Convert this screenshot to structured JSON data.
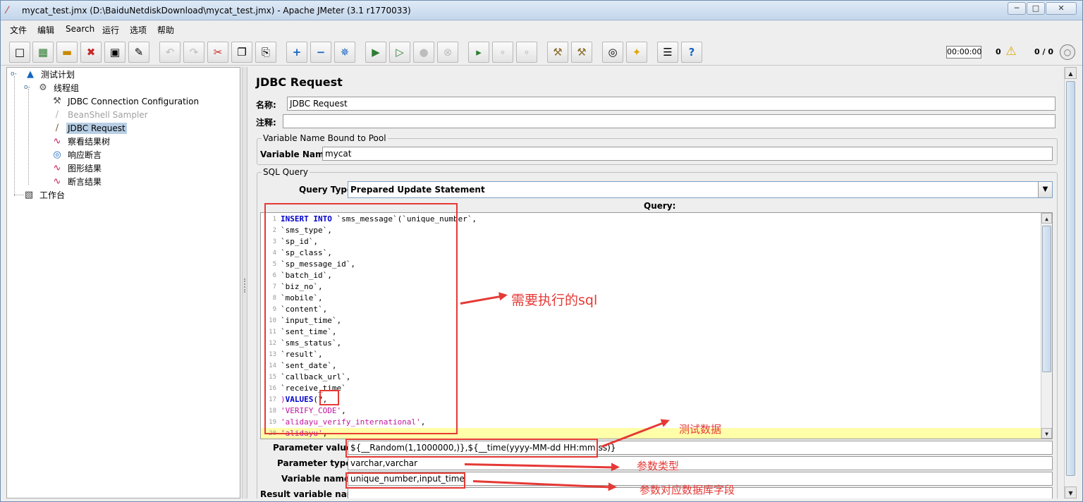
{
  "window": {
    "title": "mycat_test.jmx (D:\\BaiduNetdiskDownload\\mycat_test.jmx) - Apache JMeter (3.1 r1770033)",
    "controls": {
      "minimize": "─",
      "maximize": "□",
      "close": "✕"
    }
  },
  "menu": [
    "文件",
    "编辑",
    "Search",
    "运行",
    "选项",
    "帮助"
  ],
  "toolbar": {
    "timer": "00:00:00",
    "error_count": "0",
    "threads": "0 / 0"
  },
  "tree": {
    "root": "测试计划",
    "thread_group": "线程组",
    "children": [
      "JDBC Connection Configuration",
      "BeanShell Sampler",
      "JDBC Request",
      "察看结果树",
      "响应断言",
      "图形结果",
      "断言结果"
    ],
    "workbench": "工作台"
  },
  "panel": {
    "title": "JDBC Request",
    "name_label": "名称:",
    "name_value": "JDBC Request",
    "comment_label": "注释:",
    "comment_value": "",
    "pool_group": "Variable Name Bound to Pool",
    "var_name_label": "Variable Name:",
    "var_name_value": "mycat",
    "sql_group": "SQL Query",
    "query_type_label": "Query Type:",
    "query_type_value": "Prepared Update Statement",
    "query_label": "Query:",
    "param_values_label": "Parameter values:",
    "param_values": "${__Random(1,1000000,)},${__time(yyyy-MM-dd  HH:mm:ss)}",
    "param_types_label": "Parameter types:",
    "param_types": "varchar,varchar",
    "variable_names_label": "Variable names:",
    "variable_names": "unique_number,input_time",
    "result_var_label": "Result variable name:"
  },
  "query_lines": [
    {
      "n": "1",
      "t": "INSERT INTO `sms_message`(`unique_number`,"
    },
    {
      "n": "2",
      "t": "`sms_type`,"
    },
    {
      "n": "3",
      "t": "`sp_id`,"
    },
    {
      "n": "4",
      "t": "`sp_class`,"
    },
    {
      "n": "5",
      "t": "`sp_message_id`,"
    },
    {
      "n": "6",
      "t": "`batch_id`,"
    },
    {
      "n": "7",
      "t": "`biz_no`,"
    },
    {
      "n": "8",
      "t": "`mobile`,"
    },
    {
      "n": "9",
      "t": "`content`,"
    },
    {
      "n": "10",
      "t": "`input_time`,"
    },
    {
      "n": "11",
      "t": "`sent_time`,"
    },
    {
      "n": "12",
      "t": "`sms_status`,"
    },
    {
      "n": "13",
      "t": "`result`,"
    },
    {
      "n": "14",
      "t": "`sent_date`,"
    },
    {
      "n": "15",
      "t": "`callback_url`,"
    },
    {
      "n": "16",
      "t": "`receive_time`"
    },
    {
      "n": "17",
      "t": ")VALUES(?,"
    },
    {
      "n": "18",
      "t": "'VERIFY_CODE',"
    },
    {
      "n": "19",
      "t": "'alidayu_verify_international',"
    },
    {
      "n": "20",
      "t": "'alidayu',"
    }
  ],
  "annotations": {
    "sql_note": "需要执行的sql",
    "test_data_note": "测试数据",
    "param_type_note": "参数类型",
    "db_field_note": "参数对应数据库字段"
  }
}
